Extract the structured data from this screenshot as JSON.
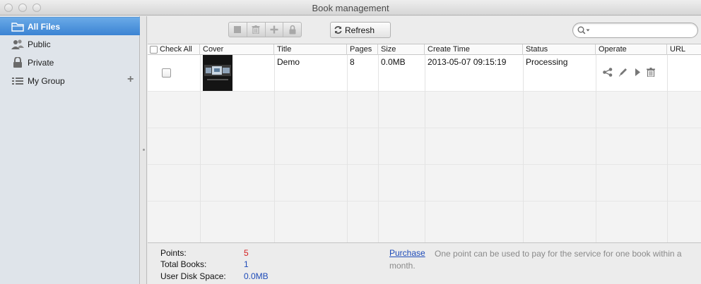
{
  "window": {
    "title": "Book management"
  },
  "sidebar": {
    "items": [
      {
        "label": "All Files",
        "icon": "folder-icon",
        "selected": true
      },
      {
        "label": "Public",
        "icon": "users-icon",
        "selected": false
      },
      {
        "label": "Private",
        "icon": "lock-icon",
        "selected": false
      },
      {
        "label": "My Group",
        "icon": "list-icon",
        "selected": false
      }
    ],
    "add_icon": "plus-icon"
  },
  "toolbar": {
    "segment_icons": [
      "stop-icon",
      "trash-icon",
      "plus-icon",
      "lock-icon"
    ],
    "refresh_label": "Refresh",
    "search": {
      "value": "",
      "placeholder": ""
    }
  },
  "table": {
    "columns": [
      "Check All",
      "Cover",
      "Title",
      "Pages",
      "Size",
      "Create Time",
      "Status",
      "Operate",
      "URL"
    ],
    "rows": [
      {
        "checked": false,
        "title": "Demo",
        "pages": "8",
        "size": "0.0MB",
        "create_time": "2013-05-07 09:15:19",
        "status": "Processing",
        "operate_icons": [
          "share-icon",
          "edit-icon",
          "play-icon",
          "trash-icon"
        ],
        "url": ""
      }
    ]
  },
  "footer": {
    "points_label": "Points:",
    "points_value": "5",
    "total_books_label": "Total Books:",
    "total_books_value": "1",
    "disk_label": "User Disk Space:",
    "disk_value": "0.0MB",
    "purchase_link": "Purchase",
    "purchase_note": "One point can be used to pay for the service for one book within a month."
  },
  "colors": {
    "selection": "#3b83d3",
    "points_value": "#d42020",
    "info_value": "#1e4bb8",
    "link": "#1e4bb8"
  }
}
